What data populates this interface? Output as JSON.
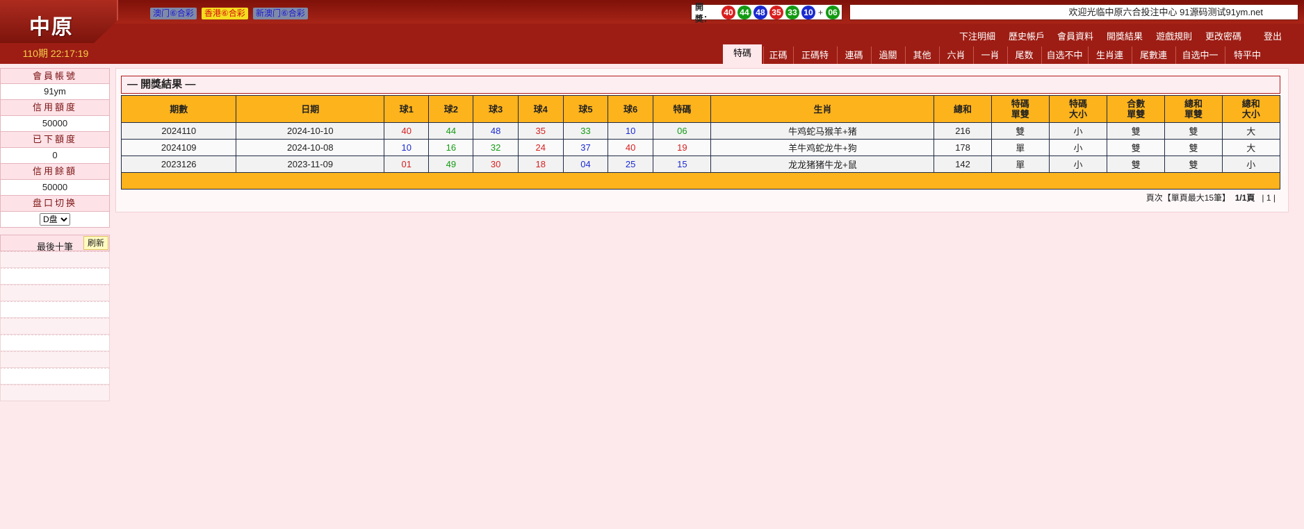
{
  "header": {
    "logo": "中原",
    "period_time": "110期 22:17:19",
    "lottery_tabs": [
      "澳门⑥合彩",
      "香港⑥合彩",
      "新澳门⑥合彩"
    ],
    "draw_label": "開獎：",
    "draw_balls": [
      {
        "num": "40",
        "color": "#d81e1e"
      },
      {
        "num": "44",
        "color": "#139b13"
      },
      {
        "num": "48",
        "color": "#1a2ad0"
      },
      {
        "num": "35",
        "color": "#d81e1e"
      },
      {
        "num": "33",
        "color": "#139b13"
      },
      {
        "num": "10",
        "color": "#1a2ad0"
      }
    ],
    "draw_plus": "+",
    "draw_special": {
      "num": "06",
      "color": "#139b13"
    },
    "welcome": "欢迎光临中原六合投注中心 91源码测试91ym.net",
    "top_nav": [
      "下注明細",
      "歷史帳戶",
      "會員資料",
      "開獎結果",
      "遊戲規則",
      "更改密碼",
      "登出"
    ],
    "game_tabs": [
      "特碼",
      "正碼",
      "正碼特",
      "連碼",
      "過關",
      "其他",
      "六肖",
      "一肖",
      "尾数",
      "自选不中",
      "生肖連",
      "尾數連",
      "自选中一",
      "特平中"
    ],
    "active_tab": "特碼"
  },
  "sidebar": {
    "account_label": "會員帳號",
    "account_value": "91ym",
    "credit_label": "信用額度",
    "credit_value": "50000",
    "placed_label": "已下額度",
    "placed_value": "0",
    "balance_label": "信用餘額",
    "balance_value": "50000",
    "pan_label": "盘口切换",
    "pan_value": "D盘",
    "recent_title": "最後十筆",
    "refresh_label": "刷新"
  },
  "results": {
    "title": "— 開獎結果 —",
    "headers": [
      "期數",
      "日期",
      "球1",
      "球2",
      "球3",
      "球4",
      "球5",
      "球6",
      "特碼",
      "生肖",
      "總和",
      "特碼\n單雙",
      "特碼\n大小",
      "合數\n單雙",
      "總和\n單雙",
      "總和\n大小"
    ],
    "rows": [
      {
        "period": "2024110",
        "date": "2024-10-10",
        "balls": [
          {
            "num": "40",
            "color": "red"
          },
          {
            "num": "44",
            "color": "green"
          },
          {
            "num": "48",
            "color": "blue"
          },
          {
            "num": "35",
            "color": "red"
          },
          {
            "num": "33",
            "color": "green"
          },
          {
            "num": "10",
            "color": "blue"
          }
        ],
        "special": {
          "num": "06",
          "color": "green"
        },
        "zodiac": "牛鸡蛇马猴羊+猪",
        "sum": "216",
        "special_odd_even": "雙",
        "special_big_small": "小",
        "combined_odd_even": "雙",
        "sum_odd_even": "雙",
        "sum_big_small": "大"
      },
      {
        "period": "2024109",
        "date": "2024-10-08",
        "balls": [
          {
            "num": "10",
            "color": "blue"
          },
          {
            "num": "16",
            "color": "green"
          },
          {
            "num": "32",
            "color": "green"
          },
          {
            "num": "24",
            "color": "red"
          },
          {
            "num": "37",
            "color": "blue"
          },
          {
            "num": "40",
            "color": "red"
          }
        ],
        "special": {
          "num": "19",
          "color": "red"
        },
        "zodiac": "羊牛鸡蛇龙牛+狗",
        "sum": "178",
        "special_odd_even": "單",
        "special_big_small": "小",
        "combined_odd_even": "雙",
        "sum_odd_even": "雙",
        "sum_big_small": "大"
      },
      {
        "period": "2023126",
        "date": "2023-11-09",
        "balls": [
          {
            "num": "01",
            "color": "red"
          },
          {
            "num": "49",
            "color": "green"
          },
          {
            "num": "30",
            "color": "red"
          },
          {
            "num": "18",
            "color": "red"
          },
          {
            "num": "04",
            "color": "blue"
          },
          {
            "num": "25",
            "color": "blue"
          }
        ],
        "special": {
          "num": "15",
          "color": "blue"
        },
        "zodiac": "龙龙猪猪牛龙+鼠",
        "sum": "142",
        "special_odd_even": "單",
        "special_big_small": "小",
        "combined_odd_even": "雙",
        "sum_odd_even": "雙",
        "sum_big_small": "小"
      }
    ],
    "pagination": {
      "prefix": "頁次【單頁最大15筆】",
      "page_info": "1/1頁",
      "pages": "| 1 |"
    }
  }
}
